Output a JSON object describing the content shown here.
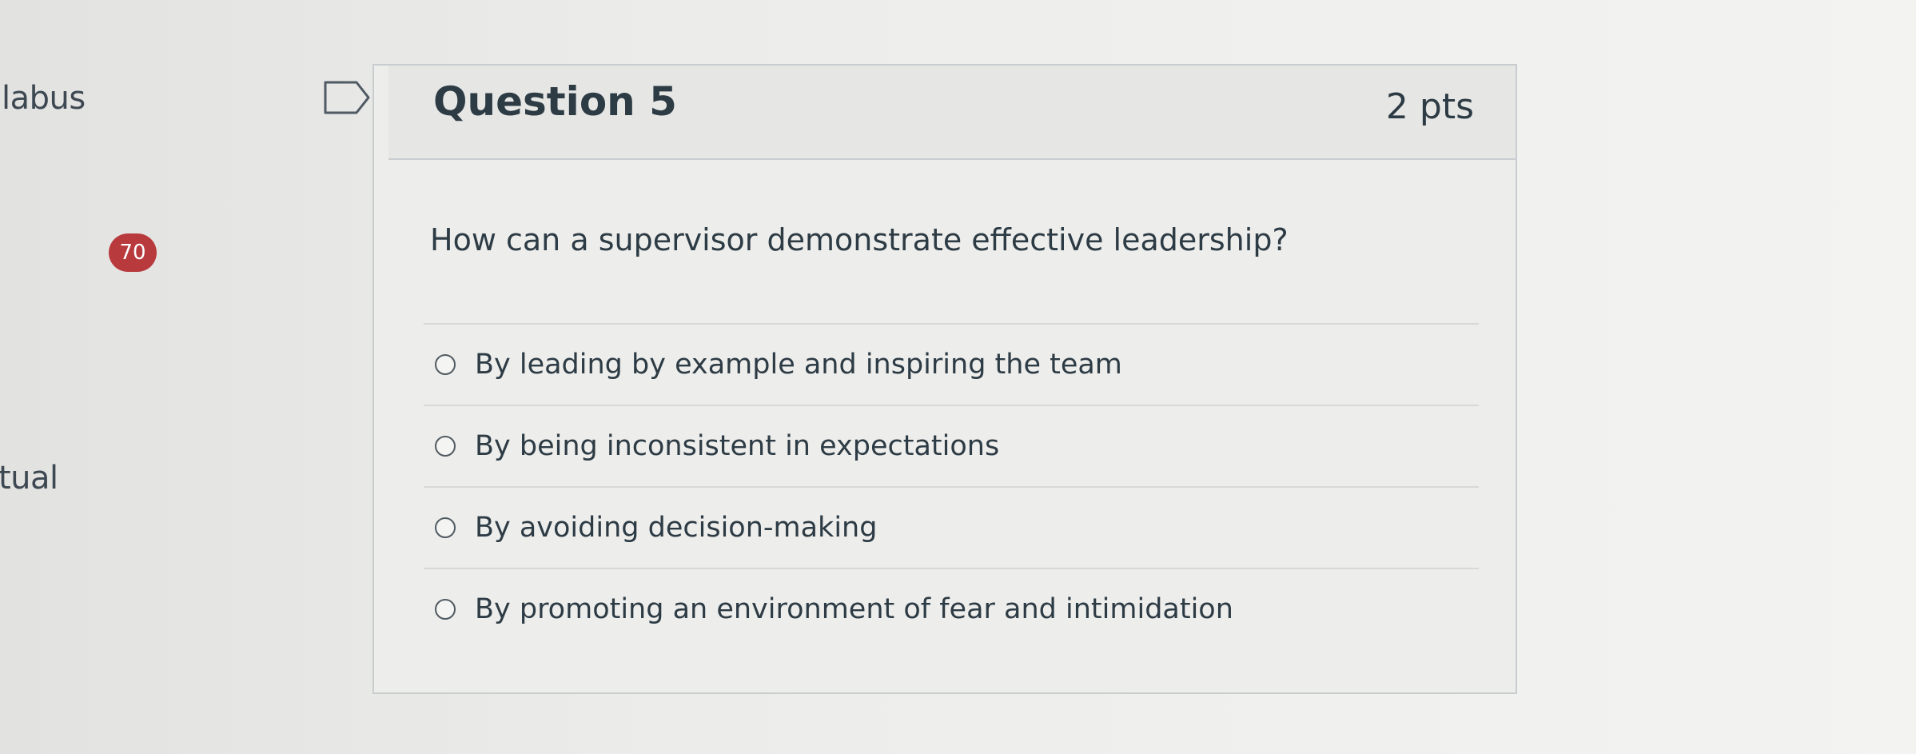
{
  "sidebar": {
    "syllabus_partial": "labus",
    "actual_partial": "tual",
    "badge_count": "70",
    "badge_color": "#b83a3d"
  },
  "question": {
    "title": "Question 5",
    "points": "2 pts",
    "text": "How can a supervisor demonstrate effective leadership?",
    "options": [
      {
        "label": "By leading by example and inspiring the team"
      },
      {
        "label": "By being inconsistent in expectations"
      },
      {
        "label": "By avoiding decision-making"
      },
      {
        "label": "By promoting an environment of fear and intimidation"
      }
    ]
  }
}
